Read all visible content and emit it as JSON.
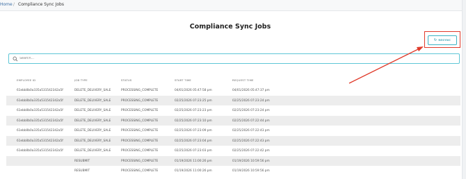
{
  "breadcrumb": {
    "home": "Home",
    "separator": "/",
    "current": "Compliance Sync Jobs"
  },
  "page": {
    "title": "Compliance Sync Jobs"
  },
  "toolbar": {
    "resync_label": "RESYNC",
    "resync_icon": "refresh-icon"
  },
  "search": {
    "placeholder": "Search...",
    "value": ""
  },
  "table": {
    "columns": [
      "EMPLOYEE ID",
      "JOB TYPE",
      "STATUS",
      "START TIME",
      "REQUEST TIME"
    ],
    "rows": [
      [
        "61ebb0b0a335a531542342a5f",
        "DELETE_DELIVERY_SALE",
        "PROCESSING_COMPLETE",
        "04/01/2026 05:47:58 pm",
        "04/01/2026 05:47:37 pm"
      ],
      [
        "61ebb0b0a335a531542342a5f",
        "DELETE_DELIVERY_SALE",
        "PROCESSING_COMPLETE",
        "02/25/2026 07:23:25 pm",
        "02/25/2026 07:23:24 pm"
      ],
      [
        "61ebb0b0a335a531542342a5f",
        "DELETE_DELIVERY_SALE",
        "PROCESSING_COMPLETE",
        "02/25/2026 07:23:23 pm",
        "02/25/2026 07:23:24 pm"
      ],
      [
        "61ebb0b0a335a531542342a5f",
        "DELETE_DELIVERY_SALE",
        "PROCESSING_COMPLETE",
        "02/25/2026 07:23:10 pm",
        "02/25/2026 07:22:44 pm"
      ],
      [
        "61ebb0b0a335a531542342a5f",
        "DELETE_DELIVERY_SALE",
        "PROCESSING_COMPLETE",
        "02/25/2026 07:23:09 pm",
        "02/25/2026 07:22:43 pm"
      ],
      [
        "61ebb0b0a335a531542342a5f",
        "DELETE_DELIVERY_SALE",
        "PROCESSING_COMPLETE",
        "02/25/2026 07:23:04 pm",
        "02/25/2026 07:22:43 pm"
      ],
      [
        "61ebb0b0a335a531542342a5f",
        "DELETE_DELIVERY_SALE",
        "PROCESSING_COMPLETE",
        "02/25/2026 07:23:03 pm",
        "02/25/2026 07:22:42 pm"
      ],
      [
        "",
        "RESUBMIT",
        "PROCESSING_COMPLETE",
        "01/19/2026 11:00:26 pm",
        "01/19/2026 10:59:56 pm"
      ],
      [
        "",
        "RESUBMIT",
        "PROCESSING_COMPLETE",
        "01/19/2026 11:00:26 pm",
        "01/19/2026 10:59:56 pm"
      ]
    ]
  },
  "annotation": {
    "color": "#e03a2a"
  },
  "colors": {
    "accent": "#3bb3c4",
    "link": "#3b6ea5"
  }
}
